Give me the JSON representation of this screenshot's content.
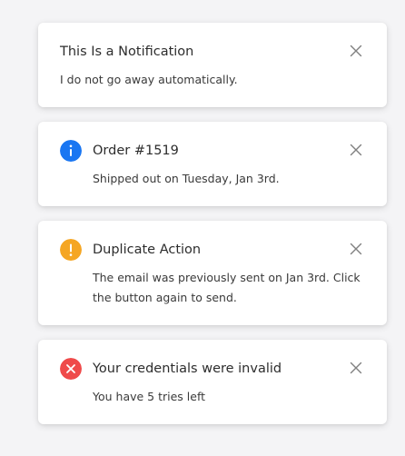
{
  "colors": {
    "info": "#1976f2",
    "warning": "#f5a623",
    "error": "#ef4a4a",
    "close": "#808080"
  },
  "notifications": [
    {
      "title": "This Is a Notification",
      "message": "I do not go away automatically.",
      "icon": "none",
      "close_icon": "close-icon"
    },
    {
      "title": "Order #1519",
      "message": "Shipped out on Tuesday, Jan 3rd.",
      "icon": "info-icon",
      "close_icon": "close-icon"
    },
    {
      "title": "Duplicate Action",
      "message": "The email was previously sent on Jan 3rd. Click the button again to send.",
      "icon": "warning-icon",
      "close_icon": "close-icon"
    },
    {
      "title": "Your credentials were invalid",
      "message": "You have 5 tries left",
      "icon": "error-icon",
      "close_icon": "close-icon"
    }
  ]
}
